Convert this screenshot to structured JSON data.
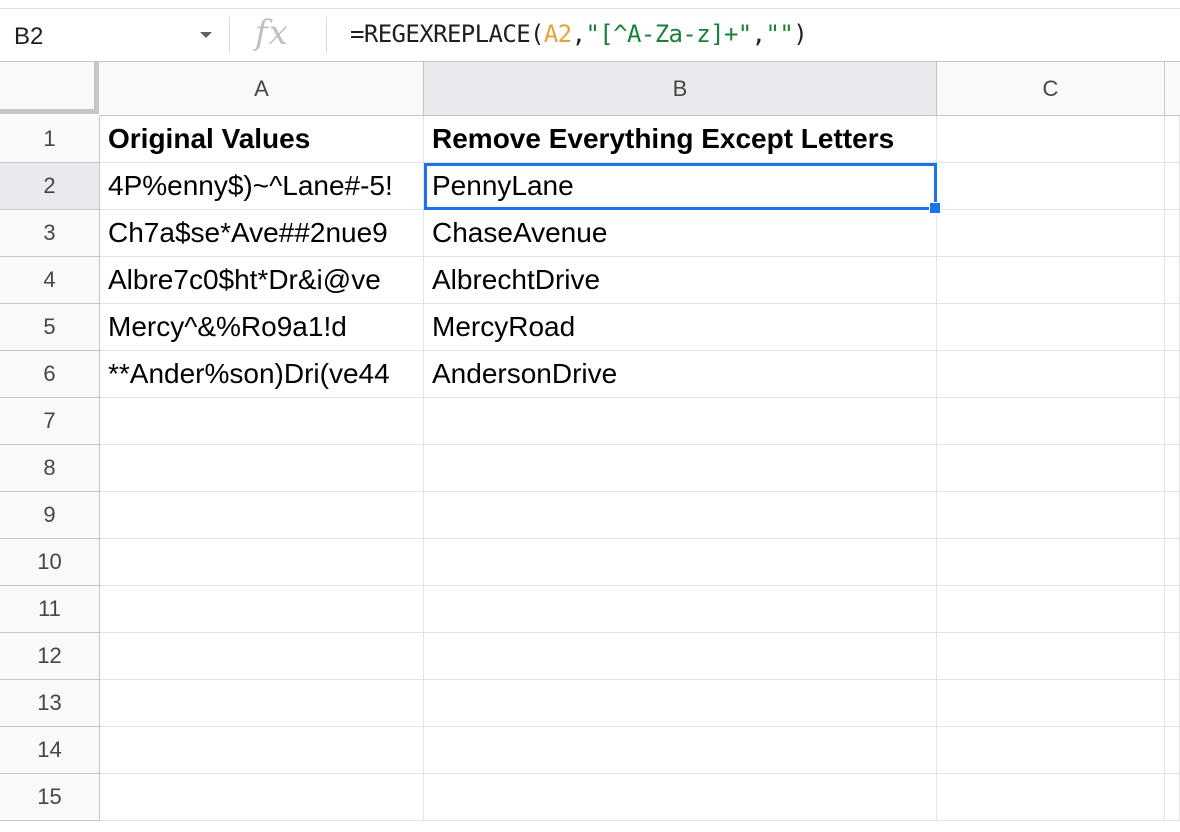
{
  "formula_bar": {
    "cell_ref": "B2",
    "fx_label": "fx",
    "formula": {
      "prefix": "=REGEXREPLACE(",
      "ref": "A2",
      "sep1": ",",
      "pattern": "\"[^A-Za-z]+\"",
      "sep2": ",",
      "replacement": "\"\"",
      "suffix": ")"
    }
  },
  "columns": [
    "A",
    "B",
    "C"
  ],
  "rows": [
    "1",
    "2",
    "3",
    "4",
    "5",
    "6",
    "7",
    "8",
    "9",
    "10",
    "11",
    "12",
    "13",
    "14",
    "15"
  ],
  "cells": {
    "A1": "Original Values",
    "B1": "Remove Everything Except Letters",
    "A2": "4P%enny$)~^Lane#-5!",
    "B2": "PennyLane",
    "A3": "Ch7a$se*Ave##2nue9",
    "B3": "ChaseAvenue",
    "A4": "Albre7c0$ht*Dr&i@ve",
    "B4": "AlbrechtDrive",
    "A5": "Mercy^&%Ro9a1!d",
    "B5": "MercyRoad",
    "A6": "**Ander%son)Dri(ve44",
    "B6": "AndersonDrive"
  },
  "selection": {
    "cell": "B2",
    "color": "#1a73e8"
  }
}
